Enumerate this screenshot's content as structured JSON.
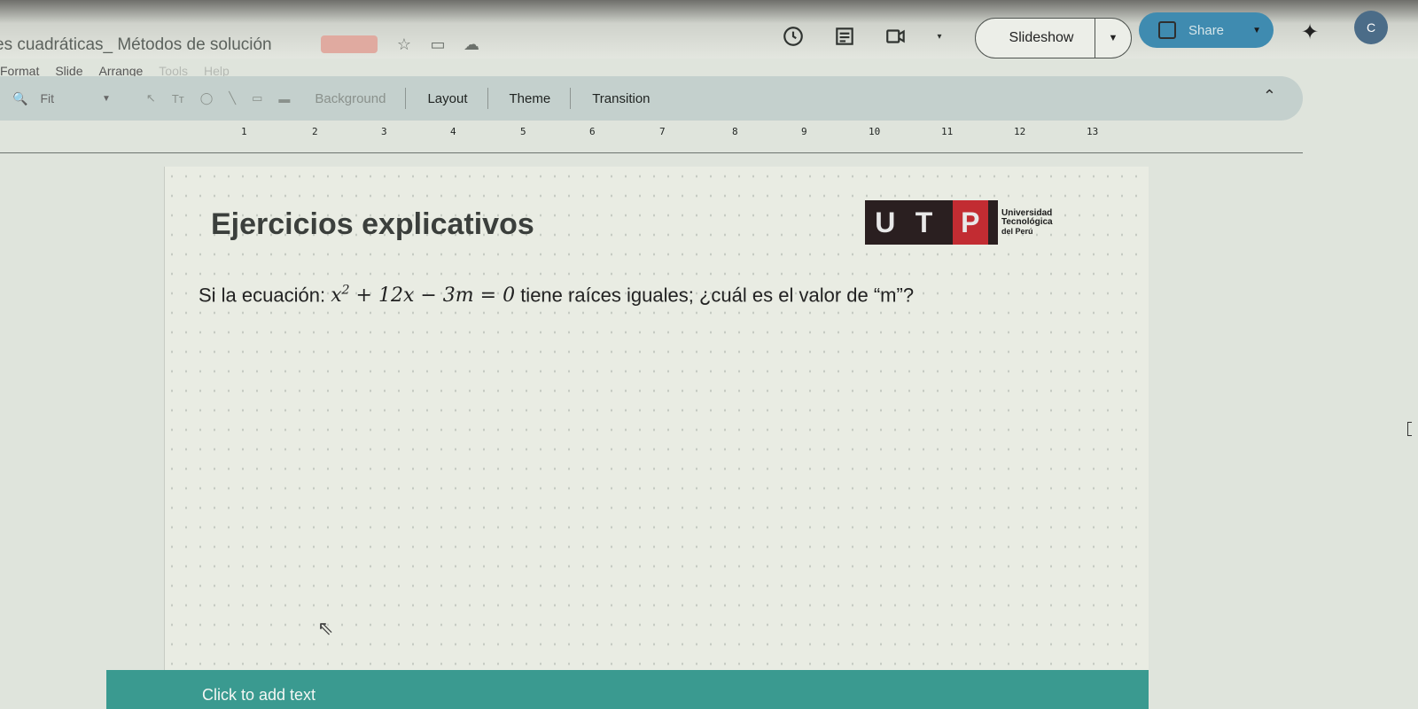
{
  "header": {
    "doc_title": "es cuadráticas_ Métodos de solución",
    "menu": [
      "Format",
      "Slide",
      "Arrange",
      "Tools",
      "Help"
    ],
    "slideshow_label": "Slideshow",
    "share_label": "Share",
    "avatar_initial": "C"
  },
  "toolbar": {
    "zoom_label": "Fit",
    "background_label": "Background",
    "layout_label": "Layout",
    "theme_label": "Theme",
    "transition_label": "Transition"
  },
  "ruler": {
    "numbers": [
      "1",
      "2",
      "3",
      "4",
      "5",
      "6",
      "7",
      "8",
      "9",
      "10",
      "11",
      "12",
      "13"
    ]
  },
  "slide": {
    "title": "Ejercicios explicativos",
    "logo_letters": [
      "U",
      "T",
      "P"
    ],
    "logo_text": [
      "Universidad",
      "Tecnológica",
      "del Perú"
    ],
    "question_prefix": "Si la ecuación: ",
    "question_suffix": " tiene raíces iguales; ¿cuál es el valor de “m”?",
    "equation": {
      "base": "x",
      "exponent": "2",
      "rest": " + 12x − 3m = 0"
    }
  },
  "notes": {
    "placeholder": "Click to add text"
  },
  "colors": {
    "share_button": "#3f8bb0",
    "notes_band": "#3a9a90",
    "logo_red": "#c22c32",
    "logo_dark": "#2a1f20"
  }
}
